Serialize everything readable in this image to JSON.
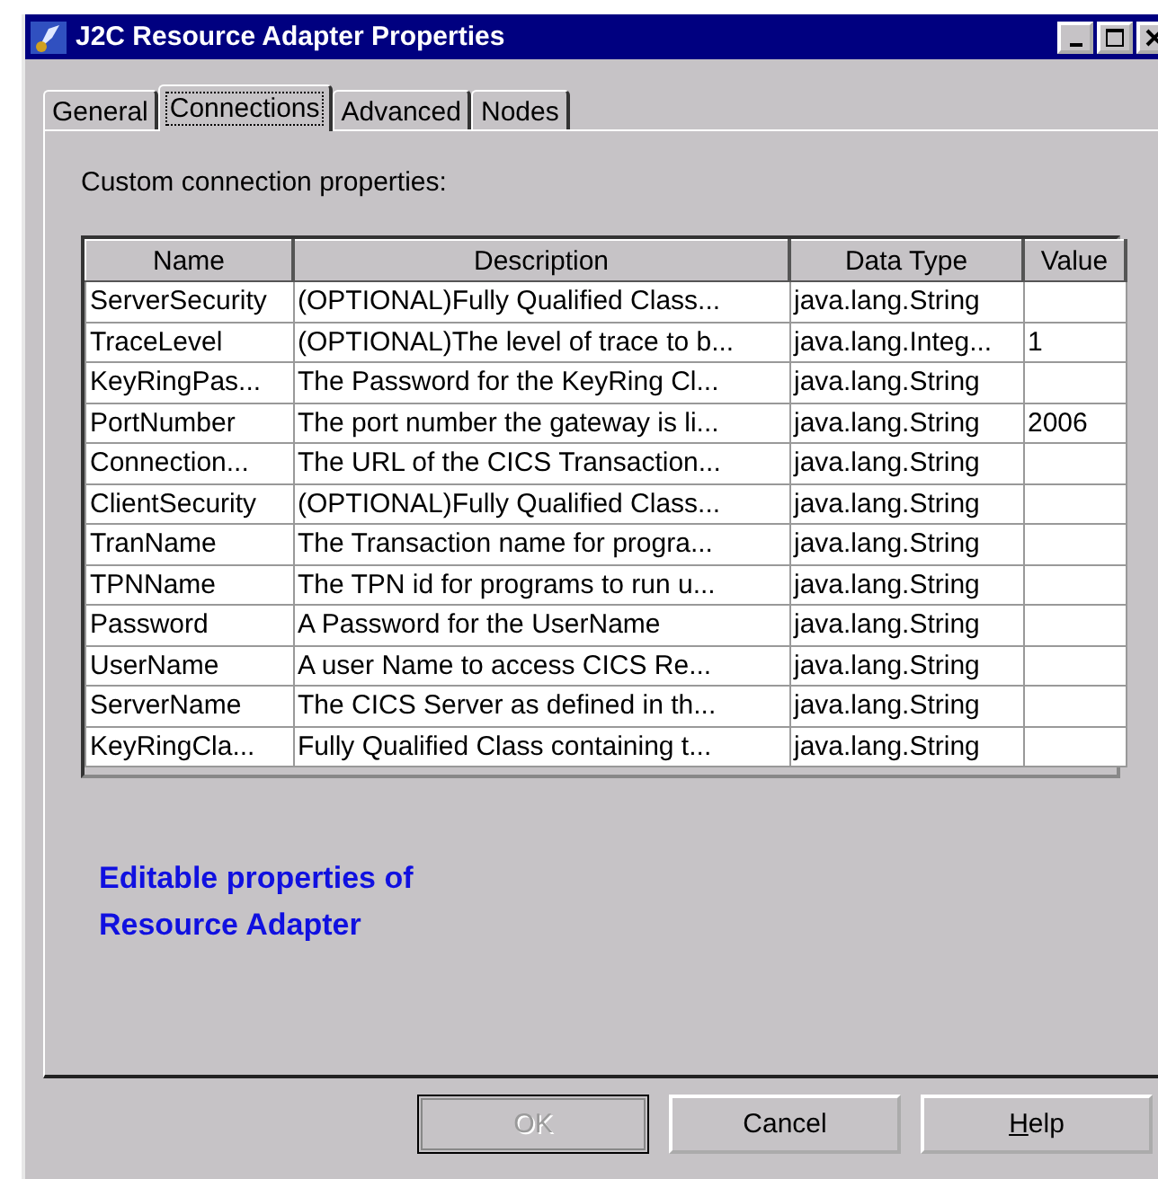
{
  "window": {
    "title": "J2C Resource Adapter Properties"
  },
  "tabs": [
    {
      "label": "General",
      "selected": false
    },
    {
      "label": "Connections",
      "selected": true
    },
    {
      "label": "Advanced",
      "selected": false
    },
    {
      "label": "Nodes",
      "selected": false
    }
  ],
  "section_label": "Custom connection properties:",
  "table": {
    "columns": [
      "Name",
      "Description",
      "Data Type",
      "Value"
    ],
    "rows": [
      [
        "ServerSecurity",
        "(OPTIONAL)Fully Qualified Class...",
        "java.lang.String",
        ""
      ],
      [
        "TraceLevel",
        "(OPTIONAL)The level of trace to b...",
        "java.lang.Integ...",
        "1"
      ],
      [
        "KeyRingPas...",
        "The Password for the KeyRing Cl...",
        "java.lang.String",
        ""
      ],
      [
        "PortNumber",
        "The port number the gateway is li...",
        "java.lang.String",
        "2006"
      ],
      [
        "Connection...",
        "The URL of the CICS Transaction...",
        "java.lang.String",
        ""
      ],
      [
        "ClientSecurity",
        "(OPTIONAL)Fully Qualified Class...",
        "java.lang.String",
        ""
      ],
      [
        "TranName",
        "The Transaction name for progra...",
        "java.lang.String",
        ""
      ],
      [
        "TPNName",
        "The TPN id for programs to run u...",
        "java.lang.String",
        ""
      ],
      [
        "Password",
        "A Password for the UserName",
        "java.lang.String",
        ""
      ],
      [
        "UserName",
        "A user Name to access CICS Re...",
        "java.lang.String",
        ""
      ],
      [
        "ServerName",
        "The CICS Server as defined in th...",
        "java.lang.String",
        ""
      ],
      [
        "KeyRingCla...",
        "Fully Qualified Class containing t...",
        "java.lang.String",
        ""
      ]
    ]
  },
  "annotation": [
    "Editable properties of",
    "Resource Adapter"
  ],
  "buttons": [
    {
      "label": "OK",
      "disabled": true,
      "mnemonic": false
    },
    {
      "label": "Cancel",
      "disabled": false,
      "mnemonic": false
    },
    {
      "label": "Help",
      "disabled": false,
      "mnemonic": true
    }
  ]
}
